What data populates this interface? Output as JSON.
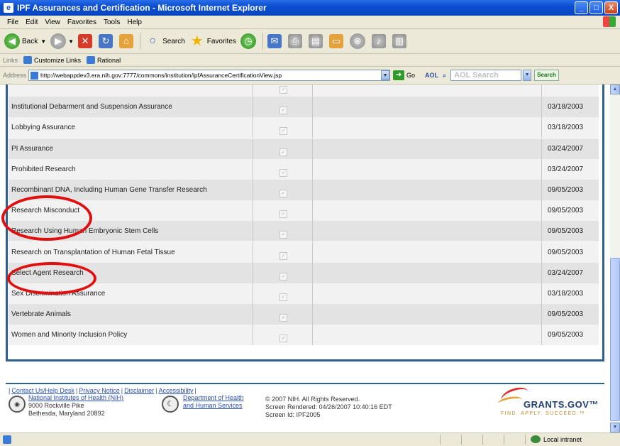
{
  "window": {
    "title": "IPF Assurances and Certification - Microsoft Internet Explorer",
    "minimize": "_",
    "maximize": "□",
    "close": "X"
  },
  "menu": [
    "File",
    "Edit",
    "View",
    "Favorites",
    "Tools",
    "Help"
  ],
  "toolbar": {
    "back": "Back",
    "search": "Search",
    "favorites": "Favorites"
  },
  "links": {
    "label": "Links",
    "items": [
      "Customize Links",
      "Rational"
    ]
  },
  "address": {
    "label": "Address",
    "url": "http://webappdev3.era.nih.gov:7777/commons/institution/ipfAssuranceCertificationView.jsp",
    "go": "Go",
    "aol": "AOL",
    "aol_placeholder": "AOL Search",
    "aol_search": "Search"
  },
  "rows": [
    {
      "name": "",
      "date": ""
    },
    {
      "name": "Institutional Debarment and Suspension Assurance",
      "date": "03/18/2003"
    },
    {
      "name": "Lobbying Assurance",
      "date": "03/18/2003"
    },
    {
      "name": "PI Assurance",
      "date": "03/24/2007"
    },
    {
      "name": "Prohibited Research",
      "date": "03/24/2007"
    },
    {
      "name": "Recombinant DNA, Including Human Gene Transfer Research",
      "date": "09/05/2003"
    },
    {
      "name": "Research Misconduct",
      "date": "09/05/2003"
    },
    {
      "name": "Research Using Human Embryonic Stem Cells",
      "date": "09/05/2003"
    },
    {
      "name": "Research on Transplantation of Human Fetal Tissue",
      "date": "09/05/2003"
    },
    {
      "name": "Select Agent Research",
      "date": "03/24/2007"
    },
    {
      "name": "Sex Discrimination Assurance",
      "date": "03/18/2003"
    },
    {
      "name": "Vertebrate Animals",
      "date": "09/05/2003"
    },
    {
      "name": "Women and Minority Inclusion Policy",
      "date": "09/05/2003"
    }
  ],
  "checkmark": "✓",
  "footer": {
    "links": [
      "Contact Us/Help Desk",
      "Privacy Notice",
      "Disclaimer",
      "Accessibility"
    ],
    "nih": {
      "name": "National Institutes of Health (NIH)",
      "addr1": "9000 Rockville Pike",
      "addr2": "Bethesda, Maryland 20892"
    },
    "hhs": {
      "line1": "Department of Health",
      "line2": "and Human Services"
    },
    "copyright": "© 2007 NIH. All Rights Reserved.",
    "rendered": "Screen Rendered: 04/26/2007 10:40:16 EDT",
    "screen_id": "Screen Id: IPF2005",
    "grants_title": "GRANTS.GOV™",
    "grants_tag": "FIND. APPLY. SUCCEED.™"
  },
  "status": {
    "zone": "Local intranet"
  }
}
